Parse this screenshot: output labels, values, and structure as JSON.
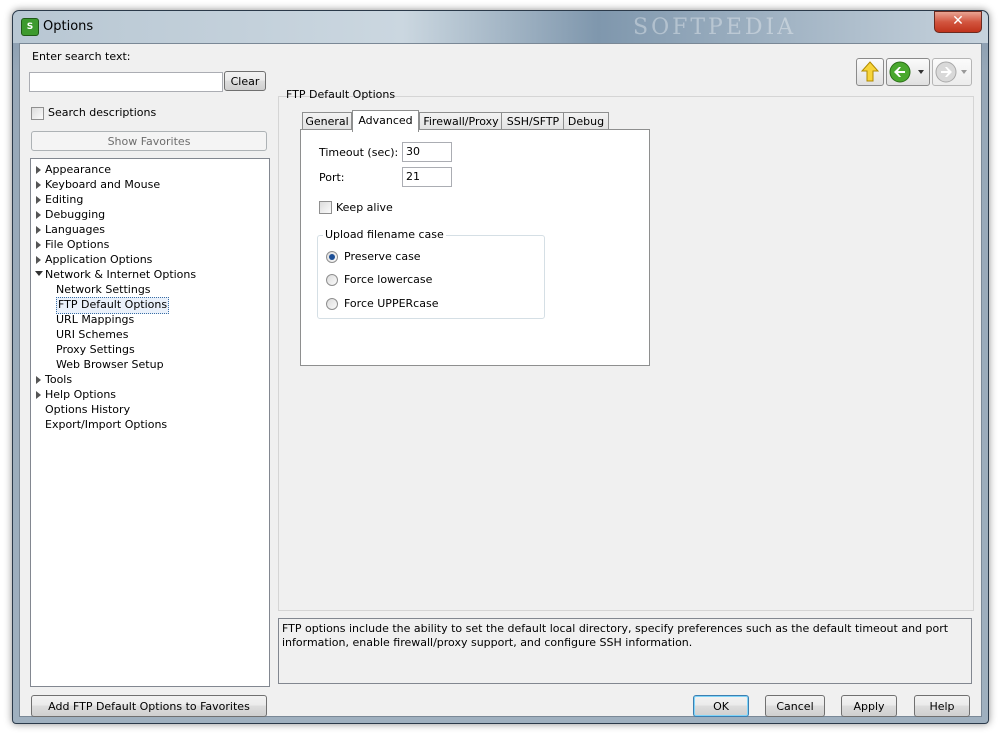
{
  "window": {
    "title": "Options",
    "app_icon_text": "S",
    "watermark": "SOFTPEDIA"
  },
  "search": {
    "label": "Enter search text:",
    "value": "",
    "clear_label": "Clear",
    "descriptions_label": "Search descriptions",
    "descriptions_checked": false
  },
  "favorites": {
    "show_label": "Show Favorites",
    "add_label": "Add FTP Default Options to Favorites"
  },
  "tree": {
    "items": [
      {
        "label": "Appearance",
        "expander": "collapsed"
      },
      {
        "label": "Keyboard and Mouse",
        "expander": "collapsed"
      },
      {
        "label": "Editing",
        "expander": "collapsed"
      },
      {
        "label": "Debugging",
        "expander": "collapsed"
      },
      {
        "label": "Languages",
        "expander": "collapsed"
      },
      {
        "label": "File Options",
        "expander": "collapsed"
      },
      {
        "label": "Application Options",
        "expander": "collapsed"
      },
      {
        "label": "Network & Internet Options",
        "expander": "expanded"
      },
      {
        "label": "Network Settings",
        "expander": "none"
      },
      {
        "label": "FTP Default Options",
        "expander": "none",
        "selected": true
      },
      {
        "label": "URL Mappings",
        "expander": "none"
      },
      {
        "label": "URI Schemes",
        "expander": "none"
      },
      {
        "label": "Proxy Settings",
        "expander": "none"
      },
      {
        "label": "Web Browser Setup",
        "expander": "none"
      },
      {
        "label": "Tools",
        "expander": "collapsed"
      },
      {
        "label": "Help Options",
        "expander": "collapsed"
      },
      {
        "label": "Options History",
        "expander": "none"
      },
      {
        "label": "Export/Import Options",
        "expander": "none"
      }
    ]
  },
  "nav": {
    "up_icon": "up-arrow-icon",
    "back_icon": "back-arrow-icon",
    "forward_icon": "forward-arrow-icon",
    "forward_enabled": false
  },
  "panel": {
    "title": "FTP Default Options",
    "tabs": [
      {
        "label": "General"
      },
      {
        "label": "Advanced",
        "active": true
      },
      {
        "label": "Firewall/Proxy"
      },
      {
        "label": "SSH/SFTP"
      },
      {
        "label": "Debug"
      }
    ],
    "timeout_label": "Timeout (sec):",
    "timeout_value": "30",
    "port_label": "Port:",
    "port_value": "21",
    "keep_alive_label": "Keep alive",
    "keep_alive_checked": false,
    "upload_group_label": "Upload filename case",
    "case_options": [
      {
        "label": "Preserve case",
        "selected": true
      },
      {
        "label": "Force lowercase",
        "selected": false
      },
      {
        "label": "Force UPPERcase",
        "selected": false
      }
    ]
  },
  "description": "FTP options include the ability to set the default local directory, specify preferences such as the default timeout and port information, enable firewall/proxy support, and configure SSH information.",
  "buttons": {
    "ok": "OK",
    "cancel": "Cancel",
    "apply": "Apply",
    "help": "Help"
  },
  "colors": {
    "accent": "#1c4f96",
    "close_button": "#c0331c",
    "selection_border": "#3a6ea5"
  }
}
